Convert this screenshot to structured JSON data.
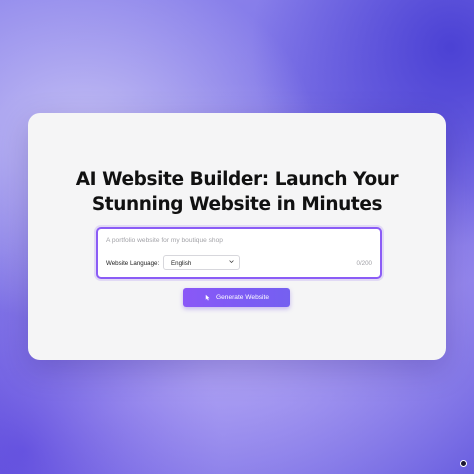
{
  "hero": {
    "title_line1": "AI Website Builder: Launch Your",
    "title_line2": "Stunning Website in Minutes"
  },
  "prompt": {
    "placeholder": "A portfolio website for my boutique shop",
    "value": "",
    "language_label": "Website Language:",
    "language_selected": "English",
    "counter": "0/200"
  },
  "actions": {
    "generate_label": "Generate Website",
    "generate_icon": "pointer-icon"
  },
  "theme": {
    "accent": "#8b5cf6",
    "button": "#8a58f7",
    "card_background": "#f5f5f6"
  }
}
